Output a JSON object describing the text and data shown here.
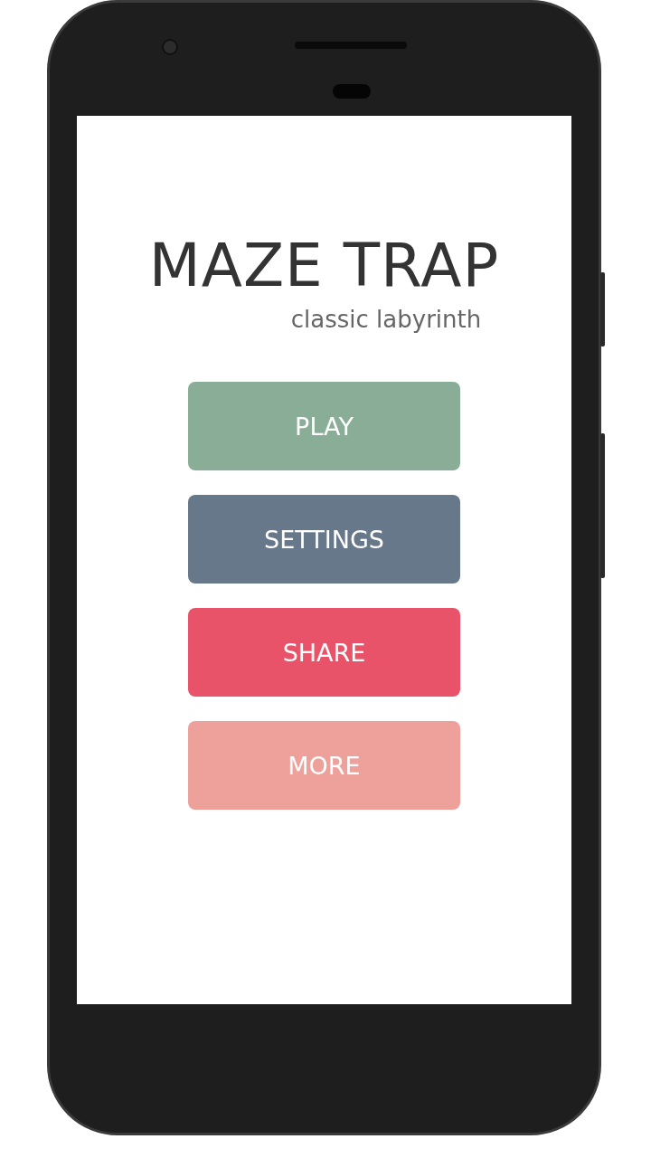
{
  "app": {
    "title": "MAZE TRAP",
    "subtitle": "classic labyrinth"
  },
  "menu": [
    {
      "label": "PLAY",
      "color": "#8aad97"
    },
    {
      "label": "SETTINGS",
      "color": "#67788a"
    },
    {
      "label": "SHARE",
      "color": "#e8536a"
    },
    {
      "label": "MORE",
      "color": "#eea19b"
    }
  ]
}
